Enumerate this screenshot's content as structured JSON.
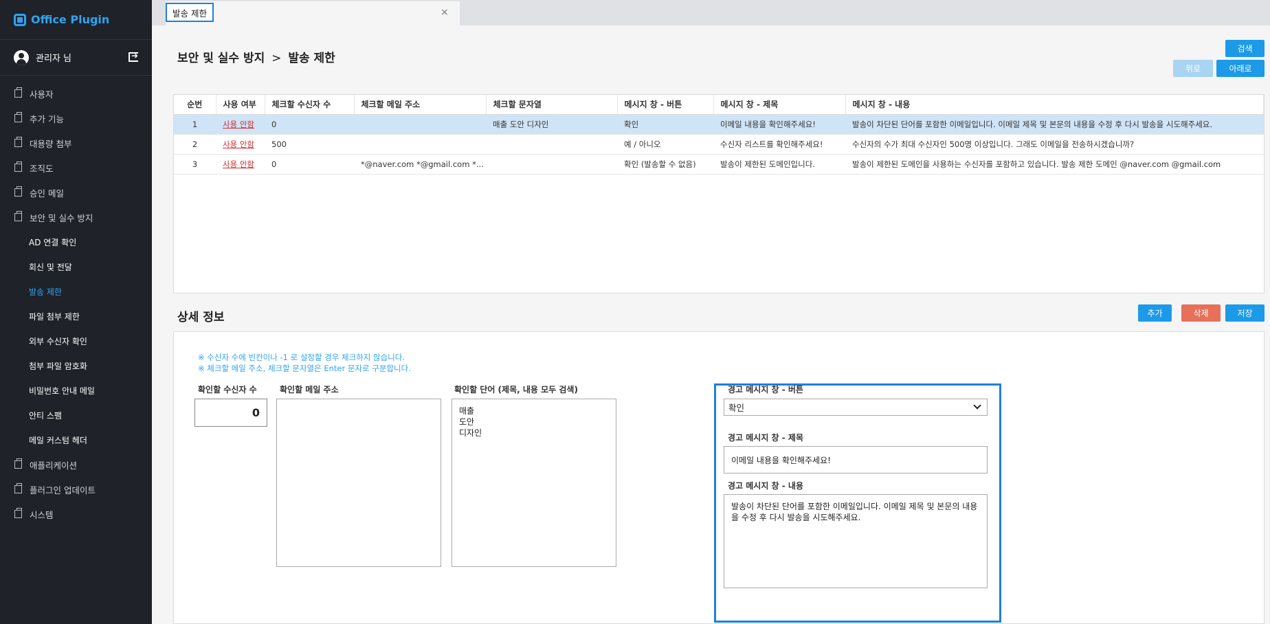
{
  "brand": {
    "title": "Office Plugin"
  },
  "user": {
    "name": "관리자 님"
  },
  "menu": [
    {
      "label": "사용자",
      "level": 1,
      "active": false
    },
    {
      "label": "추가 기능",
      "level": 1,
      "active": false
    },
    {
      "label": "대용량 첨부",
      "level": 1,
      "active": false
    },
    {
      "label": "조직도",
      "level": 1,
      "active": false
    },
    {
      "label": "승인 메일",
      "level": 1,
      "active": false
    },
    {
      "label": "보안 및 실수 방지",
      "level": 1,
      "active": false
    },
    {
      "label": "AD 연결 확인",
      "level": 2,
      "active": false
    },
    {
      "label": "회신 및 전달",
      "level": 2,
      "active": false
    },
    {
      "label": "발송 제한",
      "level": 2,
      "active": true
    },
    {
      "label": "파일 첨부 제한",
      "level": 2,
      "active": false
    },
    {
      "label": "외부 수신자 확인",
      "level": 2,
      "active": false
    },
    {
      "label": "첨부 파일 암호화",
      "level": 2,
      "active": false
    },
    {
      "label": "비밀번호 안내 메일",
      "level": 2,
      "active": false
    },
    {
      "label": "안티 스팸",
      "level": 2,
      "active": false
    },
    {
      "label": "메일 커스텀 헤더",
      "level": 2,
      "active": false
    },
    {
      "label": "애플리케이션",
      "level": 1,
      "active": false
    },
    {
      "label": "플러그인 업데이트",
      "level": 1,
      "active": false
    },
    {
      "label": "시스템",
      "level": 1,
      "active": false
    }
  ],
  "tabs": [
    {
      "label": "발송 제한",
      "close": "×"
    }
  ],
  "page": {
    "breadcrumb_parent": "보안 및 실수 방지",
    "breadcrumb_sep": ">",
    "breadcrumb_current": "발송 제한"
  },
  "toolbar": {
    "search": "검색",
    "up": "위로",
    "down": "아래로"
  },
  "table": {
    "columns": [
      "순번",
      "사용 여부",
      "체크할 수신자 수",
      "체크할 메일 주소",
      "체크할 문자열",
      "메시지 창 - 버튼",
      "메시지 창 - 제목",
      "메시지 창 - 내용"
    ],
    "rows": [
      [
        "1",
        "사용 안함",
        "0",
        "",
        "매출 도안 디자인",
        "확인",
        "이메일 내용을 확인해주세요!",
        "발송이 차단된 단어를 포함한 이메일입니다. 이메일 제목 및 본문의 내용을 수정 후 다시 발송을 시도해주세요."
      ],
      [
        "2",
        "사용 안함",
        "500",
        "",
        "",
        "예 / 아니오",
        "수신자 리스트를 확인해주세요!",
        "수신자의 수가 최대 수신자인 500명 이상입니다. 그래도 이메일을 전송하시겠습니까?"
      ],
      [
        "3",
        "사용 안함",
        "0",
        "*@naver.com *@gmail.com *...",
        "",
        "확인 (발송할 수 없음)",
        "발송이 제한된 도메인입니다.",
        "발송이 제한된 도메인을 사용하는 수신자를 포함하고 있습니다. 발송 제한 도메인 @naver.com @gmail.com"
      ]
    ]
  },
  "detail": {
    "title": "상세 정보",
    "add": "추가",
    "delete": "삭제",
    "save": "저장",
    "note1": "※ 수신자 수에 빈칸이나 -1 로 설정할 경우 체크하지 않습니다.",
    "note2": "※ 체크할 메일 주소, 체크할 문자열은 Enter 문자로 구분합니다.",
    "recipients_label": "확인할 수신자 수",
    "recipients_value": "0",
    "emails_label": "확인할 메일 주소",
    "words_label": "확인할 단어 (제목, 내용 모두 검색)",
    "words": [
      "매출",
      "도안",
      "디자인"
    ],
    "button_label": "경고 메시지 창 - 버튼",
    "button_value": "확인",
    "subject_label": "경고 메시지 창 - 제목",
    "subject_value": "이메일 내용을 확인해주세요!",
    "content_label": "경고 메시지 창 - 내용",
    "content_value": "발송이 차단된 단어를 포함한 이메일입니다. 이메일 제목 및 본문의 내용을 수정 후 다시 발송을 시도해주세요."
  }
}
